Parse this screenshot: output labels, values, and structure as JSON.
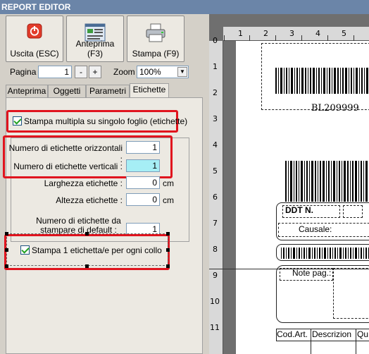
{
  "window": {
    "title": "REPORT EDITOR"
  },
  "toolbar": {
    "exit_label": "Uscita (ESC)",
    "preview_label": "Anteprima (F3)",
    "print_label": "Stampa (F9)"
  },
  "pager": {
    "page_label": "Pagina",
    "page_value": "1",
    "minus": "-",
    "plus": "+",
    "zoom_label": "Zoom",
    "zoom_value": "100%"
  },
  "tabs": [
    "Anteprima",
    "Oggetti",
    "Parametri",
    "Etichette"
  ],
  "labels_tab": {
    "multi_print_label": "Stampa multipla su singolo foglio (etichette)",
    "horizontal_label": "Numero di etichette orizzontali :",
    "horizontal_value": "1",
    "vertical_label": "Numero di etichette verticali :",
    "vertical_value": "1",
    "width_label": "Larghezza etichette :",
    "width_value": "0",
    "width_unit": "cm",
    "height_label": "Altezza etichette :",
    "height_value": "0",
    "height_unit": "cm",
    "default_label_line1": "Numero di etichette da",
    "default_label_line2": "stampare di default :",
    "default_value": "1",
    "per_package_label": "Stampa 1 etichetta/e per ogni collo"
  },
  "preview": {
    "h_ruler": [
      "1",
      "2",
      "3",
      "4",
      "5"
    ],
    "v_ruler": [
      "0",
      "1",
      "2",
      "3",
      "4",
      "5",
      "6",
      "7",
      "8",
      "9",
      "10",
      "11"
    ],
    "barcode_text": "BL209999",
    "ddt_label": "DDT N.",
    "causale_label": "Causale:",
    "note_label": "Note pag.:",
    "columns": [
      "Cod.Art.",
      "Descrizion",
      "Qu"
    ]
  }
}
